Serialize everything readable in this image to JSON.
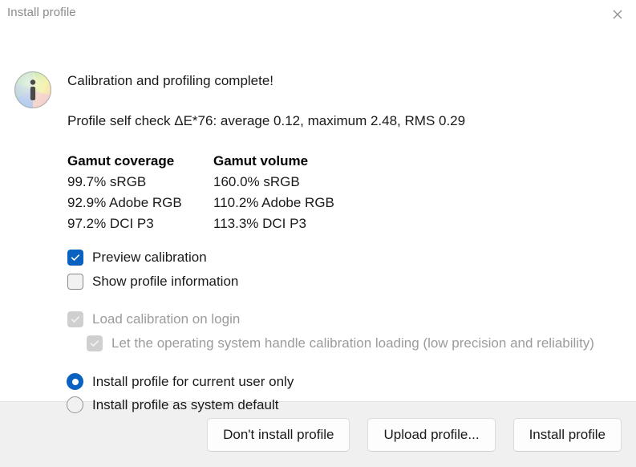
{
  "window": {
    "title": "Install profile",
    "close_icon": "close-icon"
  },
  "main": {
    "status_icon": "color-wheel-info-icon",
    "headline": "Calibration and profiling complete!",
    "self_check": "Profile self check ΔE*76: average 0.12, maximum 2.48, RMS 0.29",
    "gamut": {
      "coverage_header": "Gamut coverage",
      "volume_header": "Gamut volume",
      "coverage": [
        "99.7% sRGB",
        "92.9% Adobe RGB",
        "97.2% DCI P3"
      ],
      "volume": [
        "160.0% sRGB",
        "110.2% Adobe RGB",
        "113.3% DCI P3"
      ]
    },
    "options": [
      {
        "label": "Preview calibration",
        "checked": true,
        "enabled": true
      },
      {
        "label": "Show profile information",
        "checked": false,
        "enabled": true
      },
      {
        "label": "Load calibration on login",
        "checked": true,
        "enabled": false
      },
      {
        "label": "Let the operating system handle calibration loading (low precision and reliability)",
        "checked": true,
        "enabled": false
      }
    ],
    "install_scope": [
      {
        "label": "Install profile for current user only",
        "selected": true
      },
      {
        "label": "Install profile as system default",
        "selected": false
      }
    ]
  },
  "footer": {
    "dont_install_label": "Don't install profile",
    "upload_label": "Upload profile...",
    "install_label": "Install profile"
  },
  "colors": {
    "accent": "#0a62c0",
    "title_text": "#8a8a8a",
    "footer_bg": "#f0f0f0",
    "disabled_text": "#9b9b9b"
  }
}
